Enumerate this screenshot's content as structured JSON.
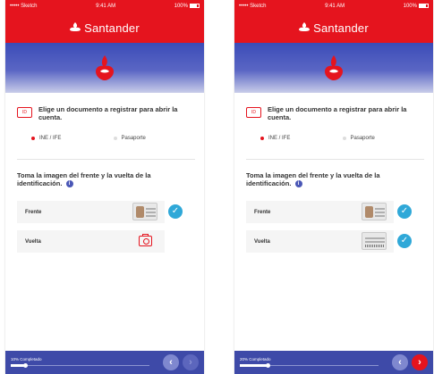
{
  "colors": {
    "brand_red": "#e5141e",
    "indigo": "#3e4aa8",
    "check_blue": "#2fa8d8"
  },
  "screens": [
    {
      "status": {
        "carrier": "••••• Sketch",
        "time": "9:41 AM",
        "battery": "100%"
      },
      "brand": {
        "name": "Santander",
        "logo_icon": "santander-flame-icon"
      },
      "doc_prompt": "Elige un documento a registrar para abrir la cuenta.",
      "doc_type_options": [
        {
          "label": "INE / IFE",
          "selected": true
        },
        {
          "label": "Pasaporte",
          "selected": false
        }
      ],
      "instruction": "Toma la imagen del frente y la vuelta de la identificación.",
      "info_glyph": "i",
      "sides": [
        {
          "label": "Frente",
          "state": "captured",
          "icon": "id-front-thumbnail",
          "checked": true
        },
        {
          "label": "Vuelta",
          "state": "empty",
          "icon": "camera-icon",
          "checked": false
        }
      ],
      "progress": {
        "label": "10% Completado",
        "value": 0.1
      },
      "nav": {
        "back": "‹",
        "next": "›",
        "next_enabled": false
      }
    },
    {
      "status": {
        "carrier": "••••• Sketch",
        "time": "9:41 AM",
        "battery": "100%"
      },
      "brand": {
        "name": "Santander",
        "logo_icon": "santander-flame-icon"
      },
      "doc_prompt": "Elige un documento a registrar para abrir la cuenta.",
      "doc_type_options": [
        {
          "label": "INE / IFE",
          "selected": true
        },
        {
          "label": "Pasaporte",
          "selected": false
        }
      ],
      "instruction": "Toma la imagen del frente y la vuelta de la identificación.",
      "info_glyph": "i",
      "sides": [
        {
          "label": "Frente",
          "state": "captured",
          "icon": "id-front-thumbnail",
          "checked": true
        },
        {
          "label": "Vuelta",
          "state": "captured",
          "icon": "id-back-thumbnail",
          "checked": true
        }
      ],
      "progress": {
        "label": "20% Completado",
        "value": 0.2
      },
      "nav": {
        "back": "‹",
        "next": "›",
        "next_enabled": true
      }
    }
  ]
}
